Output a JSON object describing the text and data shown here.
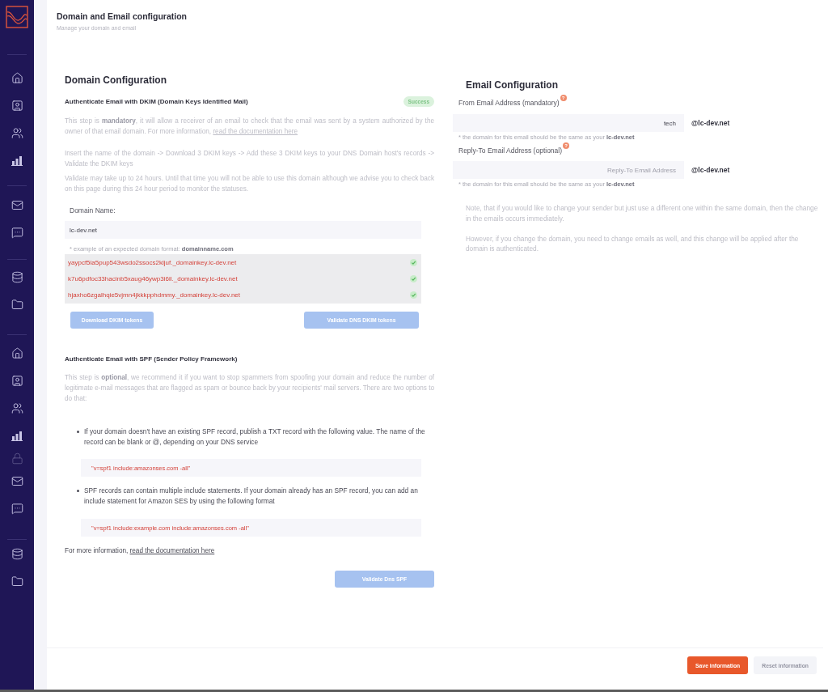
{
  "header": {
    "title": "Domain and Email configuration",
    "subtitle": "Manage your domain and email"
  },
  "domain_config": {
    "title": "Domain Configuration",
    "dkim": {
      "title": "Authenticate Email with DKIM (Domain Keys Identified Mail)",
      "status_badge": "Success",
      "paragraphs": [
        {
          "text": "This step is **mandatory**, it will allow a receiver of an email to check that the email was sent by a system authorized by the owner of that email domain. For more information, ",
          "link": "read the documentation here"
        },
        {
          "text": "Insert the name of the domain -> Download 3 DKIM keys -> Add these 3 DKIM keys to your DNS Domain host's records -> Validate the DKIM keys"
        },
        {
          "text": "Validate may take up to 24 hours. Until that time you will not be able to use this domain although we advise you to check back on this page during this 24 hour period to monitor the statuses."
        }
      ],
      "domain_field": {
        "label": "Domain Name:",
        "value": "lc-dev.net"
      },
      "hint": "* example of an expected domain format: **domainname.com**",
      "records": [
        {
          "value": "yaypcf5ia5pup543wsdo2ssocs2kljuf._domainkey.lc-dev.net",
          "verified": true
        },
        {
          "value": "k7u6pdfoc33hacinb5xaug46ywp3i6il._domainkey.lc-dev.net",
          "verified": true
        },
        {
          "value": "hjaxho6zgalhqie5vjmn4jkkkpphdmmy._domainkey.lc-dev.net",
          "verified": true
        }
      ],
      "buttons": [
        {
          "label": "Download DKIM tokens",
          "disabled": true
        },
        {
          "label": "Validate DNS DKIM tokens",
          "disabled": true
        }
      ]
    },
    "spf": {
      "title": "Authenticate Email with SPF (Sender Policy Framework)",
      "intro": "This step is **optional**, we recommend it if you want to stop spammers from spoofing your domain and reduce the number of legitimate e-mail messages that are flagged as spam or bounce back by your recipients' mail servers. There are two options to do that:",
      "options": [
        {
          "text": "If your domain doesn't have an existing SPF record, publish a TXT record with the following value. The name of the record can be blank or @, depending on your DNS service",
          "record": "\"v=spf1 include:amazonses.com -all\""
        },
        {
          "text": "SPF records can contain multiple include statements. If your domain already has an SPF record, you can add an include statement for Amazon SES by using the following format",
          "record": "\"v=spf1 include:example.com include:amazonses.com -all\""
        }
      ],
      "more_info": {
        "text": "For more information, ",
        "link": "read the documentation here"
      },
      "button": {
        "label": "Validate Dns SPF",
        "disabled": true
      }
    }
  },
  "email_config": {
    "title": "Email Configuration",
    "fields": [
      {
        "label": "From Email Address (mandatory)",
        "help_badge": "?",
        "value": "tech",
        "domain": "@lc-dev.net",
        "hint": "* the domain for this email should be the same as your **lc-dev.net**"
      },
      {
        "label": "Reply-To Email Address (optional)",
        "help_badge": "?",
        "placeholder": "Reply-To Email Address",
        "domain": "@lc-dev.net",
        "hint": "* the domain for this email should be the same as your **lc-dev.net**"
      }
    ],
    "notes": [
      "Note, that if you would like to change your sender but just use a different one within the same domain, then the change in the emails occurs immediately.",
      "However, if you change the domain, you need to change emails as well, and this change will be applied after the domain is authenticated."
    ]
  },
  "footer": {
    "buttons": [
      {
        "label": "Save information",
        "kind": "primary"
      },
      {
        "label": "Reset information",
        "kind": "secondary"
      }
    ]
  }
}
